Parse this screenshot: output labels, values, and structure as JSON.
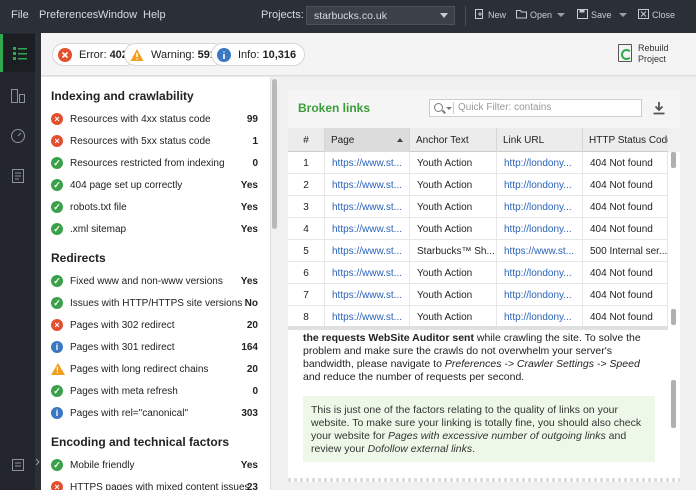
{
  "menu": {
    "file": "File",
    "preferences": "Preferences",
    "window": "Window",
    "help": "Help"
  },
  "projects": {
    "label": "Projects:",
    "selected": "starbucks.co.uk"
  },
  "toolbar": {
    "new": "New",
    "open": "Open",
    "save": "Save",
    "close": "Close"
  },
  "status": {
    "error_label": "Error:",
    "error_count": "402",
    "warning_label": "Warning:",
    "warning_count": "591",
    "info_label": "Info:",
    "info_count": "10,316"
  },
  "rebuild": {
    "line1": "Rebuild",
    "line2": "Project"
  },
  "groups": [
    {
      "title": "Indexing and crawlability",
      "items": [
        {
          "status": "error",
          "label": "Resources with 4xx status code",
          "value": "99"
        },
        {
          "status": "error",
          "label": "Resources with 5xx status code",
          "value": "1"
        },
        {
          "status": "ok",
          "label": "Resources restricted from indexing",
          "value": "0"
        },
        {
          "status": "ok",
          "label": "404 page set up correctly",
          "value": "Yes"
        },
        {
          "status": "ok",
          "label": "robots.txt file",
          "value": "Yes"
        },
        {
          "status": "ok",
          "label": ".xml sitemap",
          "value": "Yes"
        }
      ]
    },
    {
      "title": "Redirects",
      "items": [
        {
          "status": "ok",
          "label": "Fixed www and non-www versions",
          "value": "Yes"
        },
        {
          "status": "ok",
          "label": "Issues with HTTP/HTTPS site versions",
          "value": "No"
        },
        {
          "status": "error",
          "label": "Pages with 302 redirect",
          "value": "20"
        },
        {
          "status": "info",
          "label": "Pages with 301 redirect",
          "value": "164"
        },
        {
          "status": "warning",
          "label": "Pages with long redirect chains",
          "value": "20"
        },
        {
          "status": "ok",
          "label": "Pages with meta refresh",
          "value": "0"
        },
        {
          "status": "info",
          "label": "Pages with rel=\"canonical\"",
          "value": "303"
        }
      ]
    },
    {
      "title": "Encoding and technical factors",
      "items": [
        {
          "status": "ok",
          "label": "Mobile friendly",
          "value": "Yes"
        },
        {
          "status": "error",
          "label": "HTTPS pages with mixed content issues",
          "value": "23"
        }
      ]
    }
  ],
  "broken": {
    "title": "Broken links",
    "filter_placeholder": "Quick Filter: contains",
    "columns": [
      "#",
      "Page",
      "Anchor Text",
      "Link URL",
      "HTTP Status Code..."
    ],
    "rows": [
      {
        "n": "1",
        "page": "https://www.st...",
        "anchor": "Youth Action",
        "url": "http://londony...",
        "status": "404 Not found"
      },
      {
        "n": "2",
        "page": "https://www.st...",
        "anchor": "Youth Action",
        "url": "http://londony...",
        "status": "404 Not found"
      },
      {
        "n": "3",
        "page": "https://www.st...",
        "anchor": "Youth Action",
        "url": "http://londony...",
        "status": "404 Not found"
      },
      {
        "n": "4",
        "page": "https://www.st...",
        "anchor": "Youth Action",
        "url": "http://londony...",
        "status": "404 Not found"
      },
      {
        "n": "5",
        "page": "https://www.st...",
        "anchor": "Starbucks™ Sh...",
        "url": "https://www.st...",
        "status": "500 Internal ser..."
      },
      {
        "n": "6",
        "page": "https://www.st...",
        "anchor": "Youth Action",
        "url": "http://londony...",
        "status": "404 Not found"
      },
      {
        "n": "7",
        "page": "https://www.st...",
        "anchor": "Youth Action",
        "url": "http://londony...",
        "status": "404 Not found"
      },
      {
        "n": "8",
        "page": "https://www.st...",
        "anchor": "Youth Action",
        "url": "http://londony...",
        "status": "404 Not found"
      }
    ]
  },
  "description": {
    "p1_bold": "the requests WebSite Auditor sent",
    "p1_rest": " while crawling the site. To solve the problem and make sure the crawls do not overwhelm your server's bandwidth, please navigate to ",
    "p1_path": "Preferences -> Crawler Settings -> Speed",
    "p1_end": " and reduce the number of requests per second.",
    "tip_a": "This is just one of the factors relating to the quality of links on your website. To make sure your linking is totally fine, you should also check your website for ",
    "tip_b": "Pages with excessive number of outgoing links",
    "tip_c": " and review your ",
    "tip_d": "Dofollow external links",
    "tip_e": "."
  },
  "colors": {
    "ok": "#3aa14a",
    "error": "#e2502f",
    "warning": "#f0a020",
    "info": "#3a78c2",
    "accent": "#3a9d3a"
  }
}
